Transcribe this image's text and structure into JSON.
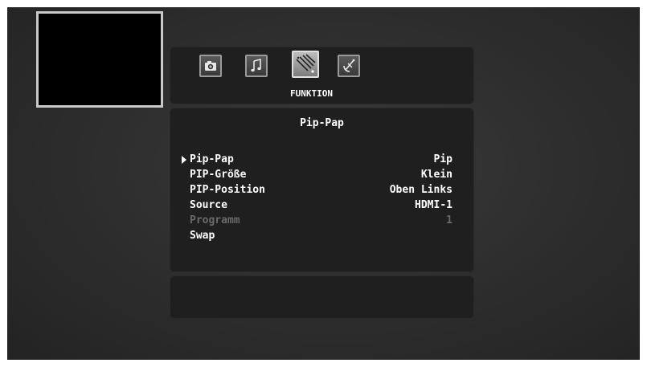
{
  "tabs": [
    {
      "name": "camera-icon"
    },
    {
      "name": "music-note-icon"
    },
    {
      "name": "function-icon",
      "active": true
    },
    {
      "name": "satellite-icon"
    }
  ],
  "active_tab_label": "FUNKTION",
  "menu": {
    "title": "Pip-Pap",
    "items": [
      {
        "label": "Pip-Pap",
        "value": "Pip",
        "selected": true
      },
      {
        "label": "PIP-Größe",
        "value": "Klein"
      },
      {
        "label": "PIP-Position",
        "value": "Oben Links"
      },
      {
        "label": "Source",
        "value": "HDMI-1"
      },
      {
        "label": "Programm",
        "value": "1",
        "disabled": true
      },
      {
        "label": "Swap",
        "value": ""
      }
    ]
  },
  "colors": {
    "text": "#ffffff",
    "disabled_text": "#6a6a6a",
    "panel": "#1f1f1f",
    "pip_border": "#c9c9c9"
  }
}
